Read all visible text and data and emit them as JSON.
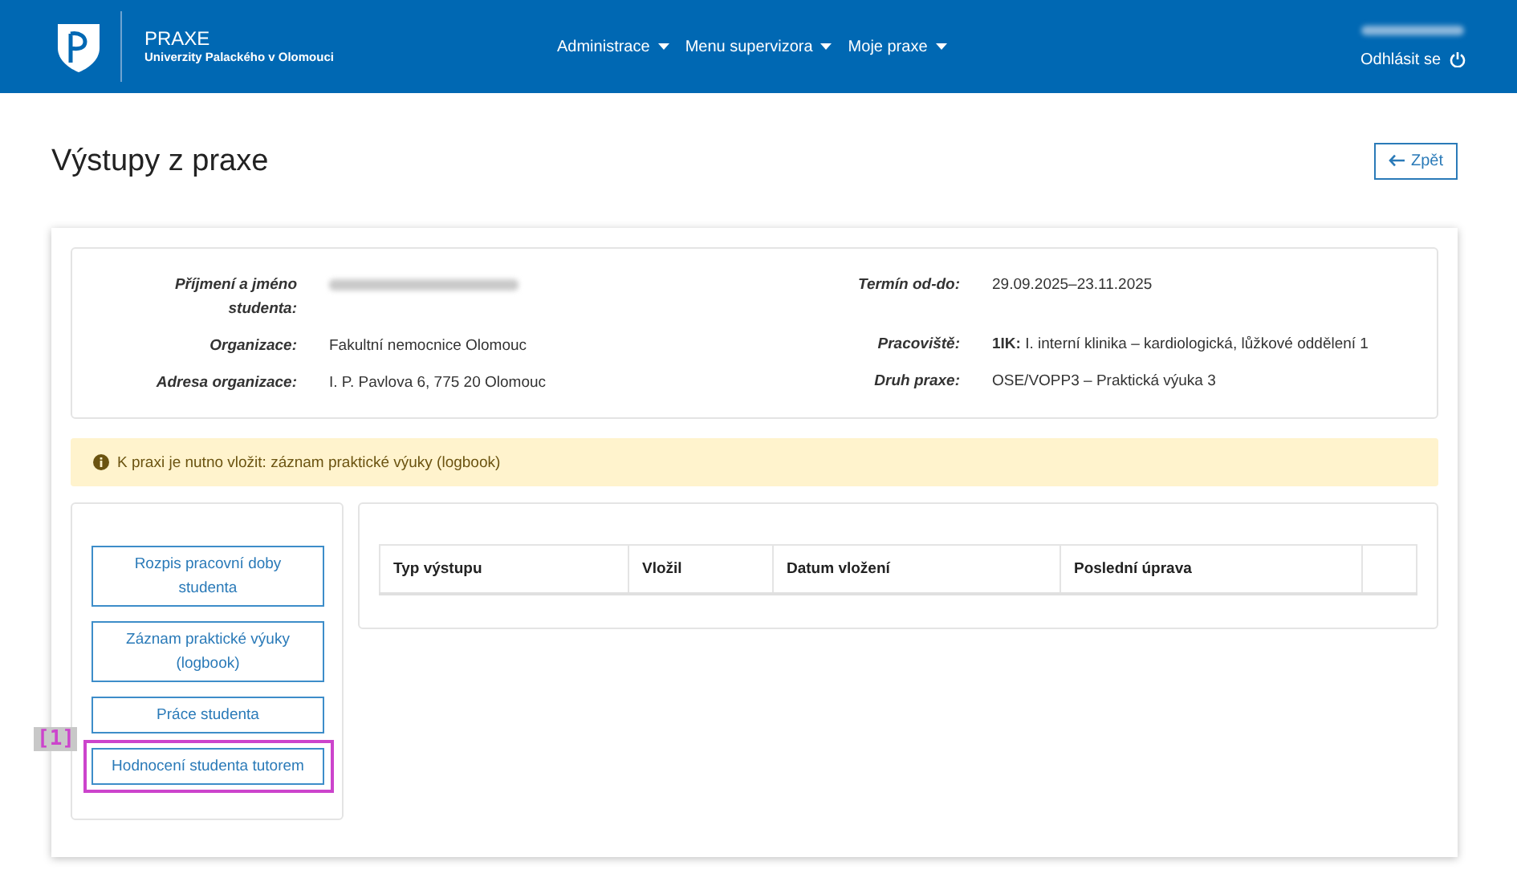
{
  "header": {
    "app_name": "PRAXE",
    "app_subtitle": "Univerzity Palackého v Olomouci",
    "menu": [
      {
        "label": "Administrace"
      },
      {
        "label": "Menu supervizora"
      },
      {
        "label": "Moje praxe"
      }
    ],
    "logout": "Odhlásit se"
  },
  "page": {
    "title": "Výstupy z praxe",
    "back_button": "Zpět"
  },
  "details_left": [
    {
      "label": "Příjmení a jméno studenta:",
      "blurred": true
    },
    {
      "label": "Organizace:",
      "value": "Fakultní nemocnice Olomouc"
    },
    {
      "label": "Adresa organizace:",
      "value": "I. P. Pavlova 6, 775 20 Olomouc"
    }
  ],
  "details_right": [
    {
      "label": "Termín od-do:",
      "value": "29.09.2025–23.11.2025"
    },
    {
      "label": "Pracoviště:",
      "value": "**1IK:** I. interní klinika – kardiologická, lůžkové oddělení 1"
    },
    {
      "label": "Druh praxe:",
      "value": "OSE/VOPP3 – Praktická výuka 3"
    }
  ],
  "alert": {
    "text": "K praxi je nutno vložit: záznam praktické výuky (logbook)"
  },
  "side_buttons": [
    {
      "label": "Rozpis pracovní doby studenta"
    },
    {
      "label": "Záznam praktické výuky (logbook)"
    },
    {
      "label": "Práce studenta"
    },
    {
      "label": "Hodnocení studenta tutorem",
      "marker": "[1]"
    }
  ],
  "table": {
    "columns": [
      "Typ výstupu",
      "Vložil",
      "Datum vložení",
      "Poslední úprava"
    ]
  }
}
